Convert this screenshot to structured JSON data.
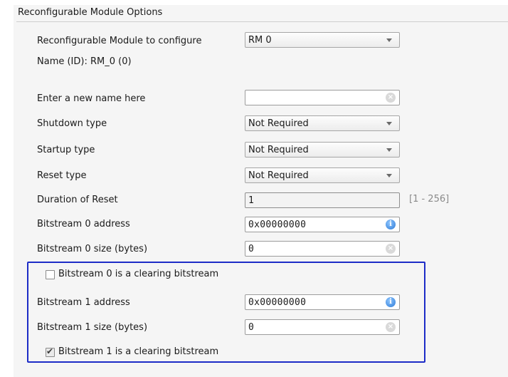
{
  "panel": {
    "title": "Reconfigurable Module Options"
  },
  "rows": {
    "rm_config": {
      "label": "Reconfigurable Module to configure",
      "value": "RM 0"
    },
    "name_id": {
      "label": "Name (ID): RM_0 (0)"
    },
    "new_name": {
      "label": "Enter a new name here",
      "value": ""
    },
    "shutdown": {
      "label": "Shutdown type",
      "value": "Not Required"
    },
    "startup": {
      "label": "Startup type",
      "value": "Not Required"
    },
    "reset": {
      "label": "Reset type",
      "value": "Not Required"
    },
    "duration": {
      "label": "Duration of Reset",
      "value": "1",
      "range": "[1 - 256]"
    },
    "bs0_addr": {
      "label": "Bitstream 0 address",
      "value": "0x00000000"
    },
    "bs0_size": {
      "label": "Bitstream 0 size (bytes)",
      "value": "0"
    },
    "bs0_clear": {
      "label": "Bitstream 0 is a clearing bitstream",
      "checked": false
    },
    "bs1_addr": {
      "label": "Bitstream 1 address",
      "value": "0x00000000"
    },
    "bs1_size": {
      "label": "Bitstream 1 size (bytes)",
      "value": "0"
    },
    "bs1_clear": {
      "label": "Bitstream 1 is a clearing bitstream",
      "checked": true
    }
  },
  "icons": {
    "clear": "clear-icon",
    "info": "info-icon",
    "dropdown": "chevron-down-icon",
    "check": "checkmark-icon"
  },
  "colors": {
    "highlight_border": "#1d2cc7",
    "info_icon": "#2e7ad6"
  }
}
